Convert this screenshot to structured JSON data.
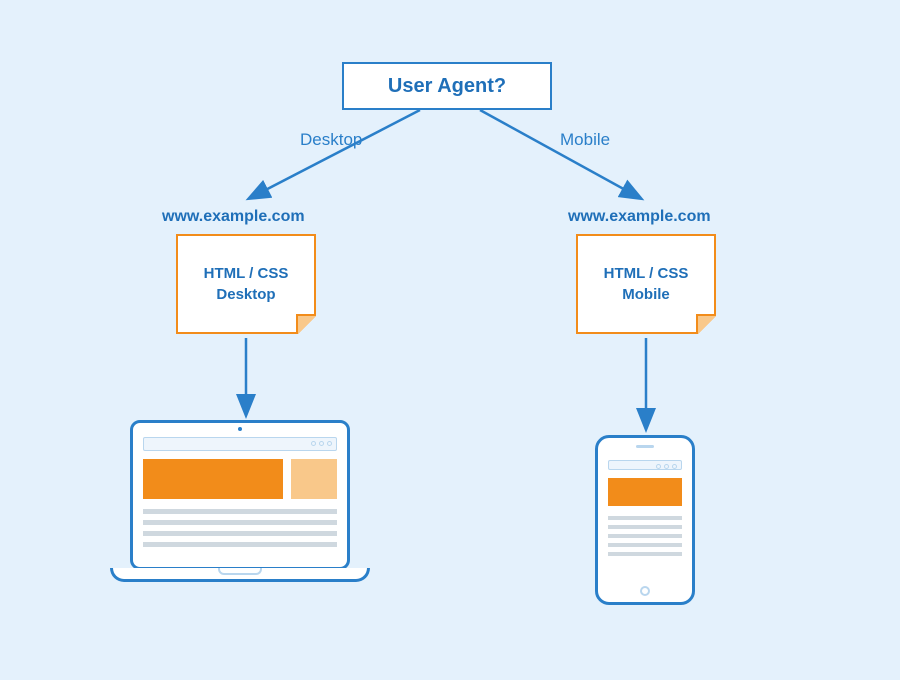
{
  "root": {
    "label": "User Agent?"
  },
  "branches": {
    "left": {
      "label": "Desktop",
      "url": "www.example.com",
      "note_line1": "HTML / CSS",
      "note_line2": "Desktop",
      "device": "laptop"
    },
    "right": {
      "label": "Mobile",
      "url": "www.example.com",
      "note_line1": "HTML / CSS",
      "note_line2": "Mobile",
      "device": "phone"
    }
  },
  "colors": {
    "background": "#e4f1fc",
    "primary": "#2a7fc9",
    "accent": "#f28c1a",
    "accent_light": "#f9c88a"
  }
}
